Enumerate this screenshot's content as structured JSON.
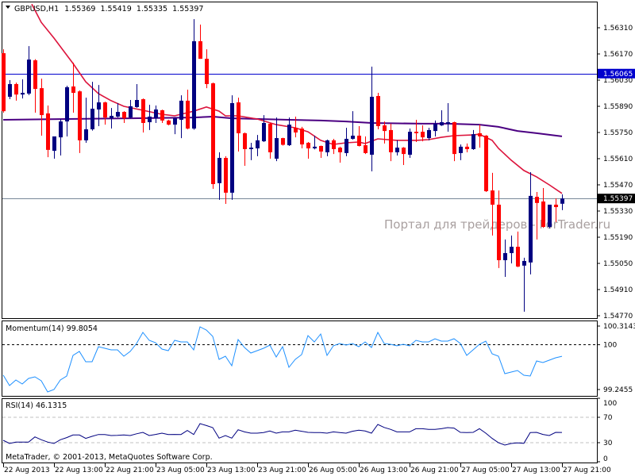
{
  "header": {
    "symbol": "GBPUSD,H1",
    "open": "1.55369",
    "high": "1.55419",
    "low": "1.55335",
    "close": "1.55397"
  },
  "watermark": "Портал для трейдеров - ForTrader.ru",
  "copyright": "MetaTrader, © 2001-2013, MetaQuotes Software Corp.",
  "colors": {
    "bull": "#000080",
    "bear": "#ff0000",
    "ma_fast": "#dc143c",
    "ma_slow": "#4b0082",
    "momentum": "#1e90ff",
    "rsi": "#000080",
    "hline_blue": "#0000cd",
    "hline_gray": "#778899"
  },
  "chart_data": [
    {
      "type": "candlestick",
      "title": "GBPUSD,H1",
      "y_ticks": [
        "1.56310",
        "1.56170",
        "1.56030",
        "1.55890",
        "1.55750",
        "1.55610",
        "1.55470",
        "1.55330",
        "1.55190",
        "1.55050",
        "1.54910",
        "1.54770"
      ],
      "ylim": [
        1.5475,
        1.5643
      ],
      "horizontal_lines": [
        {
          "value": 1.56065,
          "label": "1.56065",
          "color": "blue"
        },
        {
          "value": 1.55397,
          "label": "1.55397",
          "color": "gray"
        }
      ],
      "x_labels": [
        "22 Aug 2013",
        "22 Aug 13:00",
        "22 Aug 21:00",
        "23 Aug 05:00",
        "23 Aug 13:00",
        "23 Aug 21:00",
        "26 Aug 05:00",
        "26 Aug 13:00",
        "26 Aug 21:00",
        "27 Aug 05:00",
        "27 Aug 13:00",
        "27 Aug 21:00"
      ],
      "x_label_bar_step": 8,
      "ohlc": [
        [
          1.56174,
          1.56195,
          1.55856,
          1.55864
        ],
        [
          1.55941,
          1.5603,
          1.55928,
          1.56009
        ],
        [
          1.56009,
          1.56017,
          1.5592,
          1.55953
        ],
        [
          1.55953,
          1.56034,
          1.55932,
          1.55962
        ],
        [
          1.55958,
          1.56212,
          1.5595,
          1.5614
        ],
        [
          1.56136,
          1.56142,
          1.55856,
          1.55983
        ],
        [
          1.55987,
          1.56038,
          1.55733,
          1.55843
        ],
        [
          1.55852,
          1.55894,
          1.55618,
          1.55657
        ],
        [
          1.55652,
          1.55729,
          1.5561,
          1.55729
        ],
        [
          1.55724,
          1.55822,
          1.55627,
          1.55809
        ],
        [
          1.55809,
          1.56,
          1.55729,
          1.55992
        ],
        [
          1.55996,
          1.56123,
          1.55856,
          1.55962
        ],
        [
          1.5597,
          1.55975,
          1.5564,
          1.55708
        ],
        [
          1.55708,
          1.55936,
          1.55695,
          1.55767
        ],
        [
          1.55767,
          1.56021,
          1.5576,
          1.55877
        ],
        [
          1.55873,
          1.56004,
          1.55784,
          1.55911
        ],
        [
          1.55911,
          1.55915,
          1.55792,
          1.5583
        ],
        [
          1.55826,
          1.55881,
          1.55771,
          1.55839
        ],
        [
          1.55835,
          1.55907,
          1.5583,
          1.5586
        ],
        [
          1.5586,
          1.55864,
          1.55801,
          1.55826
        ],
        [
          1.5583,
          1.55924,
          1.55826,
          1.5589
        ],
        [
          1.55886,
          1.56009,
          1.55882,
          1.55924
        ],
        [
          1.55928,
          1.55932,
          1.5575,
          1.55801
        ],
        [
          1.55805,
          1.55898,
          1.55763,
          1.55835
        ],
        [
          1.55826,
          1.55894,
          1.55801,
          1.55873
        ],
        [
          1.55869,
          1.55872,
          1.55801,
          1.55814
        ],
        [
          1.55814,
          1.55818,
          1.55788,
          1.55792
        ],
        [
          1.55792,
          1.5583,
          1.55741,
          1.55826
        ],
        [
          1.55818,
          1.55949,
          1.5572,
          1.5592
        ],
        [
          1.5592,
          1.55979,
          1.55767,
          1.55771
        ],
        [
          1.55771,
          1.56356,
          1.55765,
          1.56238
        ],
        [
          1.56238,
          1.56327,
          1.56144,
          1.56144
        ],
        [
          1.56144,
          1.56195,
          1.55987,
          1.56009
        ],
        [
          1.56013,
          1.56017,
          1.55449,
          1.55474
        ],
        [
          1.55479,
          1.55644,
          1.5539,
          1.55614
        ],
        [
          1.55614,
          1.55623,
          1.55368,
          1.55428
        ],
        [
          1.55428,
          1.55949,
          1.5539,
          1.55907
        ],
        [
          1.55911,
          1.55936,
          1.55648,
          1.55746
        ],
        [
          1.55746,
          1.5575,
          1.55572,
          1.55661
        ],
        [
          1.55661,
          1.55695,
          1.55602,
          1.55669
        ],
        [
          1.55665,
          1.55737,
          1.55623,
          1.55708
        ],
        [
          1.55703,
          1.55843,
          1.55699,
          1.55801
        ],
        [
          1.55797,
          1.55801,
          1.5561,
          1.55644
        ],
        [
          1.5561,
          1.5583,
          1.55597,
          1.5572
        ],
        [
          1.5572,
          1.55722,
          1.5568,
          1.55684
        ],
        [
          1.55682,
          1.5583,
          1.55678,
          1.55792
        ],
        [
          1.55775,
          1.55835,
          1.55724,
          1.5575
        ],
        [
          1.55771,
          1.5578,
          1.55665,
          1.55686
        ],
        [
          1.55695,
          1.55699,
          1.5561,
          1.55665
        ],
        [
          1.55665,
          1.55733,
          1.5566,
          1.55674
        ],
        [
          1.55678,
          1.5568,
          1.55614,
          1.55648
        ],
        [
          1.55644,
          1.55712,
          1.55623,
          1.55708
        ],
        [
          1.55708,
          1.55716,
          1.55635,
          1.55661
        ],
        [
          1.55669,
          1.55674,
          1.55589,
          1.55644
        ],
        [
          1.5564,
          1.55775,
          1.55623,
          1.55716
        ],
        [
          1.55716,
          1.55864,
          1.55712,
          1.55733
        ],
        [
          1.55733,
          1.55784,
          1.55675,
          1.55678
        ],
        [
          1.55682,
          1.55729,
          1.55635,
          1.5564
        ],
        [
          1.55631,
          1.56102,
          1.55542,
          1.55941
        ],
        [
          1.55945,
          1.55962,
          1.55767,
          1.55784
        ],
        [
          1.55788,
          1.55809,
          1.55691,
          1.55758
        ],
        [
          1.55763,
          1.55797,
          1.55597,
          1.55644
        ],
        [
          1.55644,
          1.55708,
          1.55627,
          1.55669
        ],
        [
          1.55669,
          1.55672,
          1.55576,
          1.55635
        ],
        [
          1.55631,
          1.55771,
          1.55614,
          1.55754
        ],
        [
          1.55754,
          1.55818,
          1.55699,
          1.55746
        ],
        [
          1.55754,
          1.55788,
          1.55703,
          1.55724
        ],
        [
          1.5572,
          1.55775,
          1.55708,
          1.55763
        ],
        [
          1.55758,
          1.55814,
          1.55729,
          1.55797
        ],
        [
          1.55788,
          1.55869,
          1.55785,
          1.55805
        ],
        [
          1.55797,
          1.55907,
          1.55754,
          1.55805
        ],
        [
          1.55805,
          1.55808,
          1.55597,
          1.55635
        ],
        [
          1.5564,
          1.55686,
          1.55602,
          1.55674
        ],
        [
          1.55674,
          1.55691,
          1.55644,
          1.55661
        ],
        [
          1.55661,
          1.55763,
          1.55657,
          1.55741
        ],
        [
          1.55746,
          1.55792,
          1.55669,
          1.55729
        ],
        [
          1.55733,
          1.55736,
          1.55432,
          1.55436
        ],
        [
          1.5544,
          1.55534,
          1.55199,
          1.55364
        ],
        [
          1.55364,
          1.5544,
          1.55025,
          1.55067
        ],
        [
          1.55067,
          1.55178,
          1.54978,
          1.55105
        ],
        [
          1.55105,
          1.55199,
          1.5505,
          1.55139
        ],
        [
          1.55139,
          1.5522,
          1.5503,
          1.55033
        ],
        [
          1.55038,
          1.5508,
          1.54792,
          1.55063
        ],
        [
          1.55055,
          1.55538,
          1.54991,
          1.55411
        ],
        [
          1.55406,
          1.55432,
          1.55178,
          1.55373
        ],
        [
          1.55381,
          1.55453,
          1.5524,
          1.55245
        ],
        [
          1.55245,
          1.55364,
          1.55237,
          1.55364
        ],
        [
          1.55364,
          1.55398,
          1.55271,
          1.55351
        ],
        [
          1.55369,
          1.55419,
          1.55335,
          1.55397
        ]
      ],
      "ma_fast": [
        [
          4.5,
          1.56437
        ],
        [
          6,
          1.56339
        ],
        [
          8,
          1.56255
        ],
        [
          11,
          1.56119
        ],
        [
          13,
          1.56021
        ],
        [
          15,
          1.55958
        ],
        [
          17,
          1.5592
        ],
        [
          19,
          1.5589
        ],
        [
          22,
          1.55869
        ],
        [
          25,
          1.55847
        ],
        [
          27,
          1.55839
        ],
        [
          30,
          1.55864
        ],
        [
          32,
          1.55886
        ],
        [
          34,
          1.55864
        ],
        [
          35,
          1.55839
        ],
        [
          37,
          1.55839
        ],
        [
          40,
          1.55822
        ],
        [
          43,
          1.55792
        ],
        [
          46,
          1.55775
        ],
        [
          48,
          1.55754
        ],
        [
          50,
          1.55708
        ],
        [
          52,
          1.55686
        ],
        [
          54,
          1.55695
        ],
        [
          56,
          1.55699
        ],
        [
          57,
          1.55691
        ],
        [
          59,
          1.55716
        ],
        [
          62,
          1.55708
        ],
        [
          65,
          1.55708
        ],
        [
          67,
          1.55712
        ],
        [
          69,
          1.55724
        ],
        [
          71,
          1.55733
        ],
        [
          74,
          1.55737
        ],
        [
          75,
          1.55741
        ],
        [
          76,
          1.55724
        ],
        [
          77,
          1.55708
        ],
        [
          78,
          1.55665
        ],
        [
          80,
          1.55602
        ],
        [
          82,
          1.55547
        ],
        [
          84,
          1.55513
        ],
        [
          86,
          1.5547
        ],
        [
          88,
          1.55424
        ]
      ],
      "ma_slow": [
        [
          0,
          1.55818
        ],
        [
          10,
          1.55822
        ],
        [
          20,
          1.55826
        ],
        [
          30,
          1.5583
        ],
        [
          33,
          1.55835
        ],
        [
          36,
          1.55826
        ],
        [
          45,
          1.55818
        ],
        [
          50,
          1.55814
        ],
        [
          54,
          1.55809
        ],
        [
          58,
          1.55801
        ],
        [
          66,
          1.55797
        ],
        [
          70,
          1.55797
        ],
        [
          75,
          1.55792
        ],
        [
          78,
          1.5578
        ],
        [
          81,
          1.55758
        ],
        [
          84,
          1.55746
        ],
        [
          88,
          1.55729
        ]
      ]
    },
    {
      "type": "line",
      "title": "Momentum(14) 99.8054",
      "y_ticks": [
        "100.3143",
        "100",
        "99.2455"
      ],
      "ylim": [
        99.2,
        100.36
      ],
      "reference_level": 100,
      "values": [
        99.49,
        99.312,
        99.406,
        99.339,
        99.432,
        99.459,
        99.392,
        99.205,
        99.245,
        99.406,
        99.473,
        99.82,
        99.887,
        99.713,
        99.713,
        99.967,
        99.94,
        99.914,
        99.914,
        99.807,
        99.887,
        100.02,
        100.207,
        100.074,
        100.034,
        99.927,
        99.9,
        100.074,
        100.047,
        100.047,
        99.914,
        100.301,
        100.248,
        100.141,
        99.753,
        99.807,
        99.646,
        100.087,
        99.954,
        99.86,
        99.9,
        99.94,
        99.994,
        99.793,
        99.967,
        99.62,
        99.753,
        99.834,
        100.154,
        100.047,
        100.181,
        99.82,
        99.981,
        100.02,
        99.994,
        100.02,
        99.967,
        100.047,
        99.954,
        100.207,
        100.02,
        100.007,
        99.981,
        100.007,
        99.981,
        100.074,
        100.047,
        100.047,
        100.101,
        100.061,
        100.061,
        100.101,
        100.02,
        99.82,
        99.914,
        100.007,
        100.061,
        99.847,
        99.807,
        99.513,
        99.54,
        99.566,
        99.486,
        99.473,
        99.727,
        99.7,
        99.74,
        99.78,
        99.8054
      ]
    },
    {
      "type": "line",
      "title": "RSI(14) 46.1315",
      "y_ticks": [
        "100",
        "70",
        "30",
        "0"
      ],
      "ylim": [
        0,
        100
      ],
      "levels": [
        70,
        30
      ],
      "values": [
        33.7,
        28.7,
        30.9,
        31,
        30.9,
        39.1,
        34.6,
        31,
        28.7,
        34.6,
        38,
        42.1,
        42.1,
        36.7,
        40,
        42.9,
        42.9,
        41.2,
        41.5,
        42.1,
        41.2,
        44,
        46.2,
        41.2,
        43,
        45,
        42.9,
        43,
        42.9,
        49.2,
        42.9,
        60,
        57,
        53.7,
        37.1,
        41.2,
        37.1,
        50.4,
        47,
        45,
        45,
        46,
        48.4,
        45,
        47,
        47,
        49.6,
        48,
        46.2,
        46,
        46,
        45,
        47,
        46,
        45,
        48,
        49.6,
        48.4,
        45,
        58.7,
        54,
        51,
        47,
        47,
        47,
        52,
        52,
        51,
        51,
        52,
        53.7,
        53,
        46.2,
        46,
        46.2,
        52,
        45,
        36.7,
        30,
        26.2,
        28.7,
        29.6,
        29,
        46,
        46.2,
        43,
        41.2,
        46.2,
        46.1315
      ]
    }
  ]
}
